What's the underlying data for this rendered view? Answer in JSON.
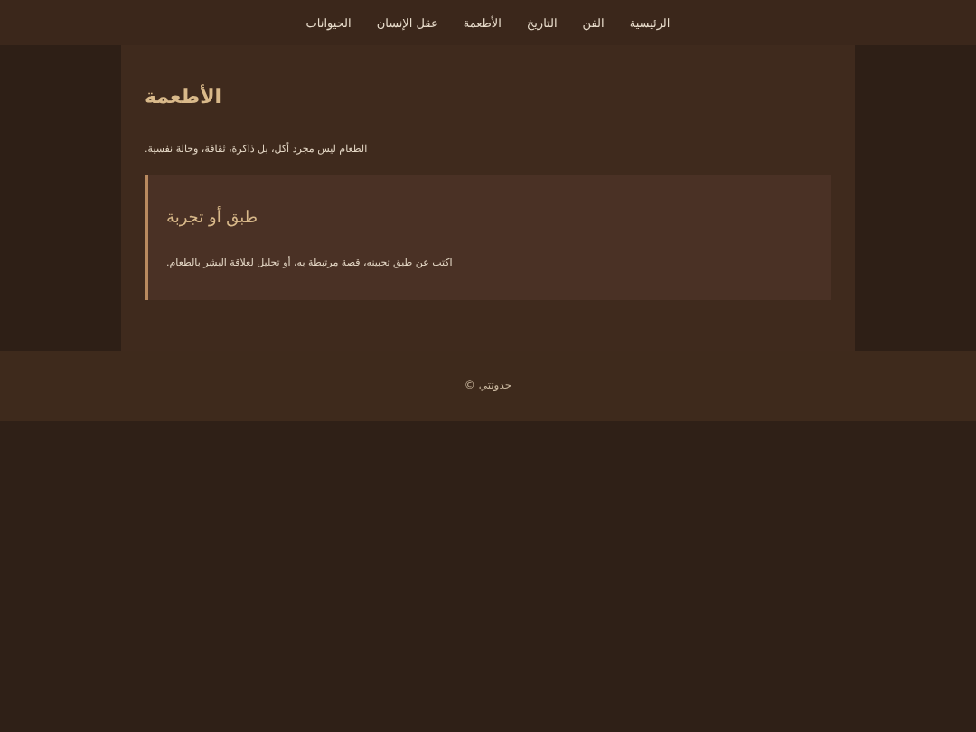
{
  "nav": {
    "items": [
      "الرئيسية",
      "الفن",
      "التاريخ",
      "الأطعمة",
      "عقل الإنسان",
      "الحيوانات"
    ]
  },
  "main": {
    "title": "الأطعمة",
    "intro": "الطعام ليس مجرد أكل، بل ذاكرة، ثقافة، وحالة نفسية.",
    "card": {
      "title": "طبق أو تجربة",
      "text": "اكتب عن طبق تحبينه، قصة مرتبطة به، أو تحليل لعلاقة البشر بالطعام."
    }
  },
  "footer": {
    "text": "حدوتتي ©"
  }
}
